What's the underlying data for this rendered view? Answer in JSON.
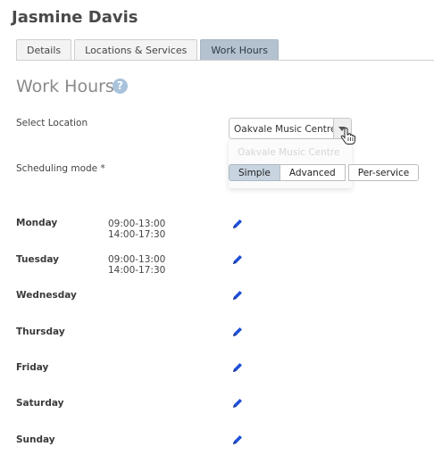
{
  "header": {
    "title": "Jasmine Davis"
  },
  "tabs": [
    {
      "label": "Details"
    },
    {
      "label": "Locations & Services"
    },
    {
      "label": "Work Hours"
    }
  ],
  "section": {
    "title": "Work Hours",
    "help_glyph": "?"
  },
  "location": {
    "label": "Select Location",
    "value": "Oakvale Music Centre",
    "dropdown_option": "Oakvale Music Centre"
  },
  "scheduling": {
    "label": "Scheduling mode *",
    "options": [
      "Simple",
      "Advanced",
      "Per-service"
    ],
    "selected": "Simple"
  },
  "days": [
    {
      "name": "Monday",
      "times": [
        "09:00-13:00",
        "14:00-17:30"
      ]
    },
    {
      "name": "Tuesday",
      "times": [
        "09:00-13:00",
        "14:00-17:30"
      ]
    },
    {
      "name": "Wednesday",
      "times": []
    },
    {
      "name": "Thursday",
      "times": []
    },
    {
      "name": "Friday",
      "times": []
    },
    {
      "name": "Saturday",
      "times": []
    },
    {
      "name": "Sunday",
      "times": []
    }
  ],
  "colors": {
    "accent": "#1f4fd6",
    "active_tab": "#b4c1cf",
    "help_icon": "#a9c3db"
  },
  "icons": {
    "edit": "pencil-icon",
    "help": "help-icon",
    "cursor": "hand-cursor-icon"
  }
}
